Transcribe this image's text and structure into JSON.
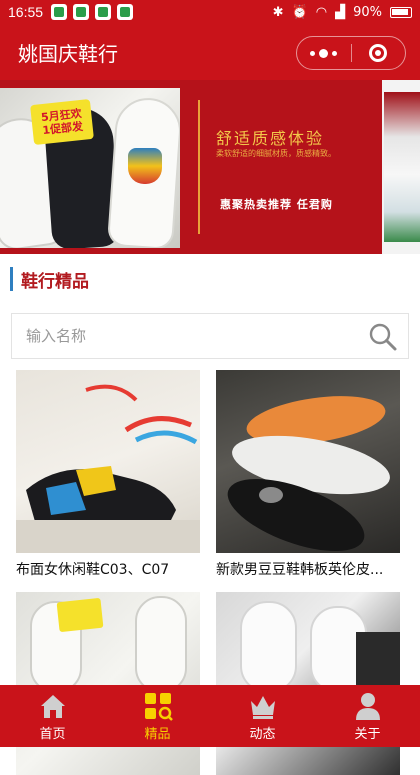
{
  "status_bar": {
    "time": "16:55",
    "battery": "90%"
  },
  "header": {
    "title": "姚国庆鞋行"
  },
  "banner": {
    "badge_line1": "5月狂欢",
    "badge_line2": "1促部发",
    "headline": "舒适质感体验",
    "subline": "柔软舒适的细腻材质，质感精致。",
    "cta": "惠聚热卖推荐 任君购"
  },
  "section": {
    "title": "鞋行精品"
  },
  "search": {
    "placeholder": "输入名称",
    "value": ""
  },
  "products": [
    {
      "name": "布面女休闲鞋C03、C07"
    },
    {
      "name": "新款男豆豆鞋韩板英伦皮..."
    },
    {
      "name": ""
    },
    {
      "name": ""
    }
  ],
  "tabs": [
    {
      "label": "首页",
      "icon": "home-icon",
      "active": false
    },
    {
      "label": "精品",
      "icon": "grid-icon",
      "active": true
    },
    {
      "label": "动态",
      "icon": "crown-icon",
      "active": false
    },
    {
      "label": "关于",
      "icon": "person-icon",
      "active": false
    }
  ],
  "colors": {
    "brand_red": "#c9131a",
    "active_tab": "#f7d100",
    "section_title": "#b21a1f"
  }
}
